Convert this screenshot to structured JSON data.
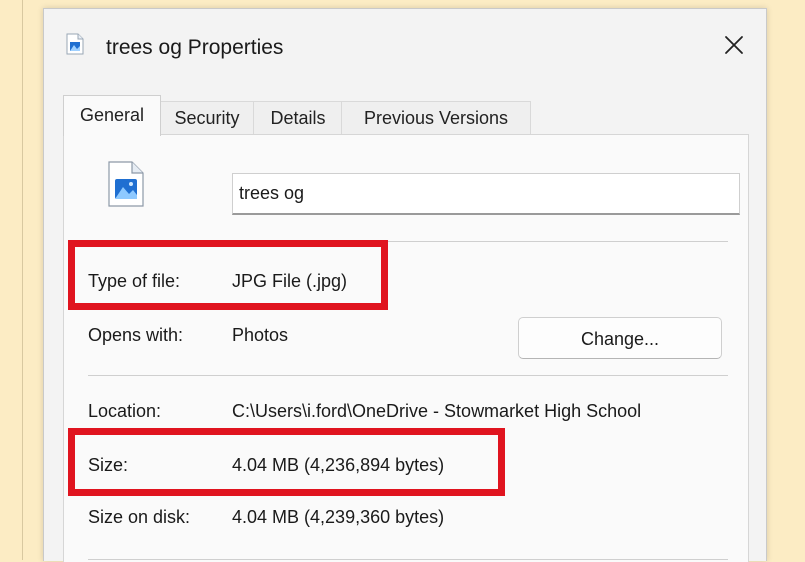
{
  "dialog": {
    "title": "trees og Properties",
    "close_label": "✕"
  },
  "tabs": [
    {
      "label": "General",
      "active": true
    },
    {
      "label": "Security",
      "active": false
    },
    {
      "label": "Details",
      "active": false
    },
    {
      "label": "Previous Versions",
      "active": false
    }
  ],
  "general": {
    "file_name": "trees og",
    "type_label": "Type of file:",
    "type_value": "JPG File (.jpg)",
    "opens_label": "Opens with:",
    "opens_value": "Photos",
    "change_button": "Change...",
    "location_label": "Location:",
    "location_value": "C:\\Users\\i.ford\\OneDrive - Stowmarket High School",
    "size_label": "Size:",
    "size_value": "4.04 MB (4,236,894 bytes)",
    "size_on_disk_label": "Size on disk:",
    "size_on_disk_value": "4.04 MB (4,239,360 bytes)"
  },
  "annotations": {
    "highlight_color": "#e0141f"
  },
  "colors": {
    "background": "#fcecc4",
    "dialog": "#f3f3f3",
    "icon_blue": "#1f6fd1"
  }
}
